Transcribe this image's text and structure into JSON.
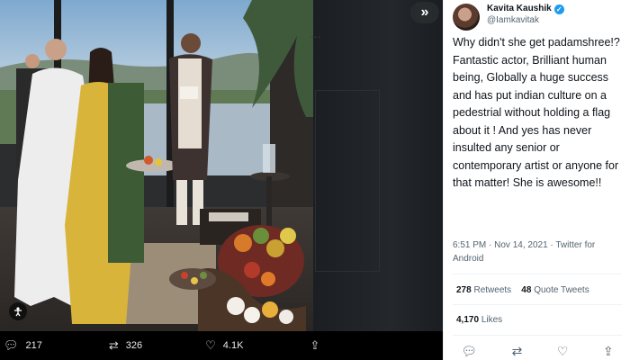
{
  "media": {
    "collapse_icon": "chevrons-right-icon",
    "alt_badge_icon": "accessibility-icon"
  },
  "action_bar": {
    "replies": "217",
    "retweets": "326",
    "likes": "4.1K",
    "icons": [
      "reply-icon",
      "retweet-icon",
      "heart-icon",
      "share-icon"
    ]
  },
  "tweet": {
    "author_name": "Kavita Kaushik",
    "author_handle": "@Iamkavitak",
    "text": "Why didn't she get padamshree!? Fantastic actor, Brilliant human being, Globally a huge success and has put indian culture on a pedestrial without holding a flag about it ! And yes has never insulted any senior or contemporary artist or anyone for that matter! She is awesome!!",
    "time": "6:51 PM",
    "date": "Nov 14, 2021",
    "source": "Twitter for Android",
    "retweets_count": "278",
    "retweets_label": "Retweets",
    "quote_count": "48",
    "quote_label": "Quote Tweets",
    "likes_count": "4,170",
    "likes_label": "Likes"
  },
  "colors": {
    "verified": "#1d9bf0",
    "text_primary": "#0f1419",
    "text_secondary": "#536471",
    "media_bg": "#0c0f12"
  }
}
